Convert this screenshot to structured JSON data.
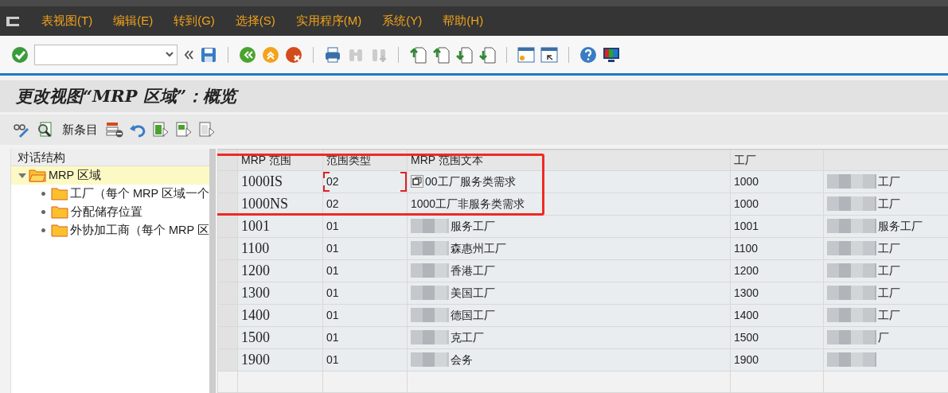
{
  "menu": [
    {
      "label": "表视图(T)"
    },
    {
      "label": "编辑(E)"
    },
    {
      "label": "转到(G)"
    },
    {
      "label": "选择(S)"
    },
    {
      "label": "实用程序(M)"
    },
    {
      "label": "系统(Y)"
    },
    {
      "label": "帮助(H)"
    }
  ],
  "title": "更改视图“MRP 区域”：概览",
  "app_toolbar": {
    "new_entries": "新条目"
  },
  "tree": {
    "title": "对话结构",
    "items": [
      {
        "label": "MRP 区域",
        "selected": true,
        "expanded": true,
        "children": [
          {
            "label": "工厂（每个 MRP 区域一个",
            "selected": false
          },
          {
            "label": "分配储存位置",
            "selected": false
          },
          {
            "label": "外协加工商（每个 MRP 区",
            "selected": false
          }
        ]
      }
    ]
  },
  "table": {
    "columns": [
      "MRP 范围",
      "范围类型",
      "MRP 范围文本",
      "工厂"
    ],
    "rows": [
      {
        "cells": [
          "1000IS",
          "02",
          "00工厂服务类需求",
          "1000",
          "工厂"
        ],
        "focused": true
      },
      {
        "cells": [
          "1000NS",
          "02",
          "1000工厂非服务类需求",
          "1000",
          "工厂"
        ],
        "focused": false
      },
      {
        "cells": [
          "1001",
          "01",
          "服务工厂",
          "1001",
          "服务工厂"
        ],
        "focused": false
      },
      {
        "cells": [
          "1100",
          "01",
          "森惠州工厂",
          "1100",
          "工厂"
        ],
        "focused": false
      },
      {
        "cells": [
          "1200",
          "01",
          "香港工厂",
          "1200",
          "工厂"
        ],
        "focused": false
      },
      {
        "cells": [
          "1300",
          "01",
          "美国工厂",
          "1300",
          "工厂"
        ],
        "focused": false
      },
      {
        "cells": [
          "1400",
          "01",
          "德国工厂",
          "1400",
          "工厂"
        ],
        "focused": false
      },
      {
        "cells": [
          "1500",
          "01",
          "克工厂",
          "1500",
          "厂"
        ],
        "focused": false
      },
      {
        "cells": [
          "1900",
          "01",
          "会务",
          "1900",
          ""
        ],
        "focused": false
      }
    ]
  }
}
